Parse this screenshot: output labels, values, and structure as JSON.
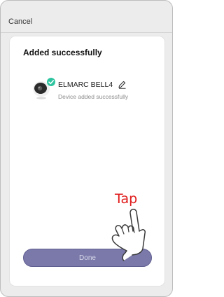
{
  "header": {
    "cancel_label": "Cancel"
  },
  "card": {
    "title": "Added successfully",
    "device": {
      "name": "ELMARC BELL4",
      "status": "Device added successfully",
      "icon": "camera-icon",
      "badge_icon": "check-badge-icon",
      "edit_icon": "pencil-icon"
    }
  },
  "annotation": {
    "tap_label": "Tap",
    "hand_icon": "pointing-hand-icon"
  },
  "actions": {
    "done_label": "Done"
  },
  "colors": {
    "button_fill": "#7a79a9",
    "button_text": "#d9d9ec",
    "check_badge": "#2ec4a0",
    "annotation": "#e01b1b"
  }
}
